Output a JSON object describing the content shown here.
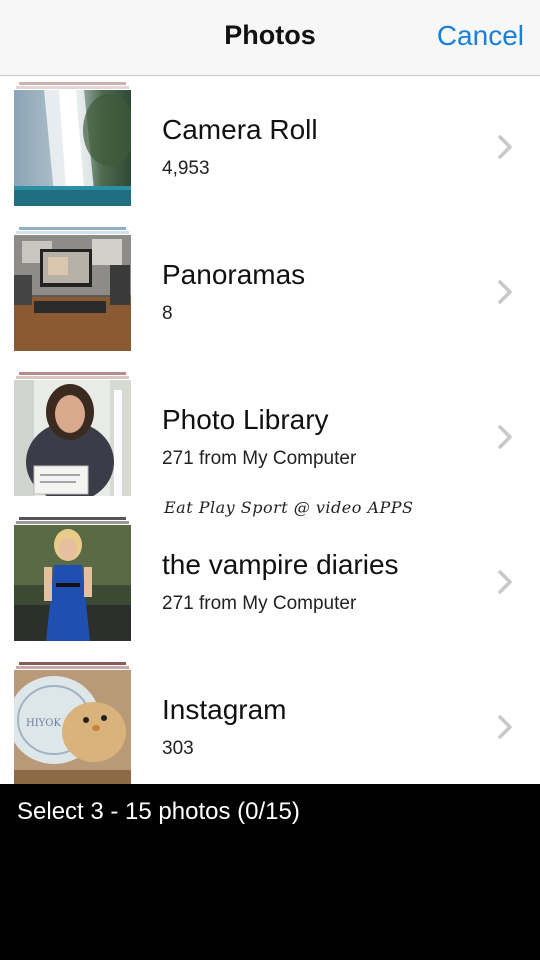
{
  "nav": {
    "title": "Photos",
    "cancel_label": "Cancel"
  },
  "albums": [
    {
      "title": "Camera Roll",
      "subtitle": "4,953"
    },
    {
      "title": "Panoramas",
      "subtitle": "8"
    },
    {
      "title": "Photo Library",
      "subtitle": "271 from My Computer"
    },
    {
      "title": "the vampire diaries",
      "subtitle": "271 from My Computer"
    },
    {
      "title": "Instagram",
      "subtitle": "303"
    }
  ],
  "watermark": "Eat Play Sport @ video APPS",
  "footer": {
    "selection_text": "Select 3 - 15 photos (0/15)"
  },
  "colors": {
    "accent": "#1a7fd6",
    "chevron": "#c7c7cc"
  }
}
